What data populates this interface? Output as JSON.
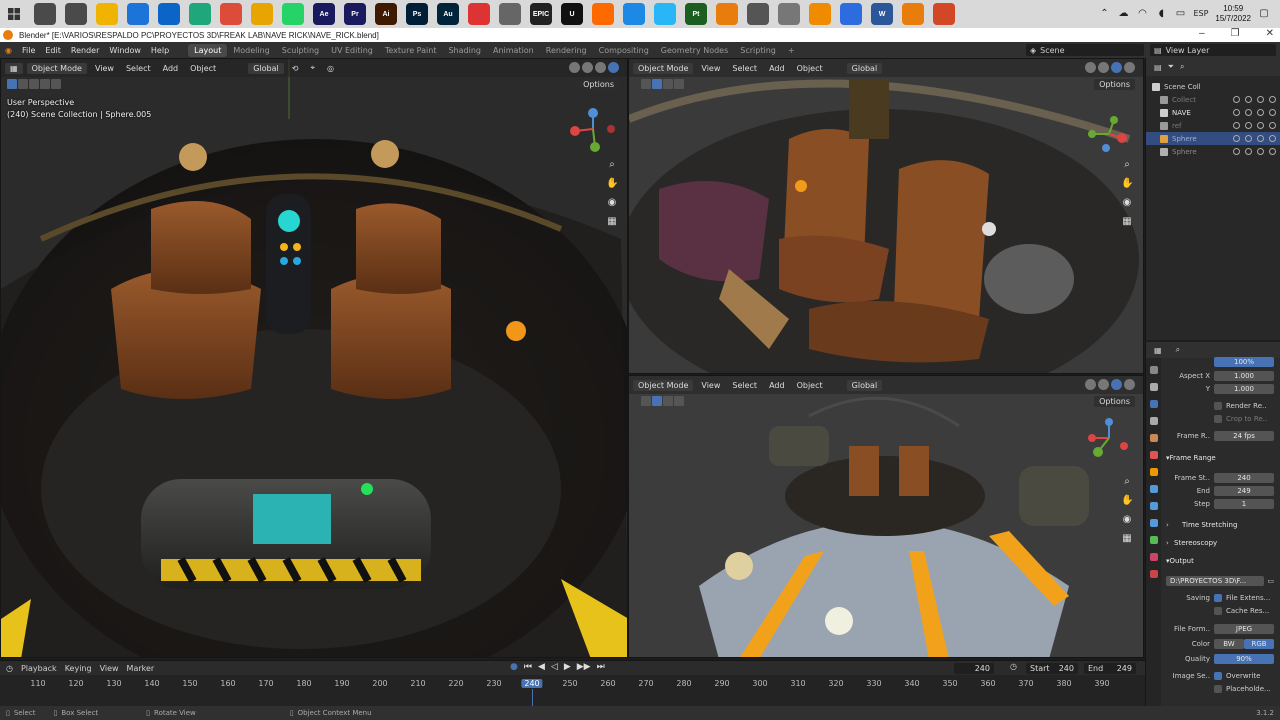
{
  "taskbar": {
    "apps": [
      {
        "name": "search-icon",
        "color": "#4a4a4a",
        "label": ""
      },
      {
        "name": "task-view-icon",
        "color": "#4a4a4a",
        "label": ""
      },
      {
        "name": "file-explorer-icon",
        "color": "#f0b400",
        "label": ""
      },
      {
        "name": "calendar-icon",
        "color": "#1c74d9",
        "label": ""
      },
      {
        "name": "mail-icon",
        "color": "#0d64c7",
        "label": ""
      },
      {
        "name": "edge-icon",
        "color": "#1fa67a",
        "label": ""
      },
      {
        "name": "chrome-icon",
        "color": "#dd4b39",
        "label": ""
      },
      {
        "name": "chrome-alt-icon",
        "color": "#e8a400",
        "label": ""
      },
      {
        "name": "whatsapp-icon",
        "color": "#25d366",
        "label": ""
      },
      {
        "name": "after-effects-icon",
        "color": "#1a1a5e",
        "label": "Ae"
      },
      {
        "name": "premiere-icon",
        "color": "#1a1a5e",
        "label": "Pr"
      },
      {
        "name": "illustrator-icon",
        "color": "#3d1a00",
        "label": "Ai"
      },
      {
        "name": "photoshop-icon",
        "color": "#001e36",
        "label": "Ps"
      },
      {
        "name": "audition-icon",
        "color": "#00243a",
        "label": "Au"
      },
      {
        "name": "app-red-icon",
        "color": "#d33",
        "label": ""
      },
      {
        "name": "app-white-icon",
        "color": "#666",
        "label": ""
      },
      {
        "name": "epic-games-icon",
        "color": "#222",
        "label": "EPIC"
      },
      {
        "name": "unreal-icon",
        "color": "#111",
        "label": "U"
      },
      {
        "name": "app-orange-icon",
        "color": "#ff6a00",
        "label": ""
      },
      {
        "name": "app-blue-icon",
        "color": "#1e88e5",
        "label": ""
      },
      {
        "name": "app-cyan-icon",
        "color": "#29b6f6",
        "label": ""
      },
      {
        "name": "painter-icon",
        "color": "#1b5e20",
        "label": "Pt"
      },
      {
        "name": "blender-alt-icon",
        "color": "#e87d0d",
        "label": ""
      },
      {
        "name": "app-grey-icon",
        "color": "#555",
        "label": ""
      },
      {
        "name": "app-grey2-icon",
        "color": "#777",
        "label": ""
      },
      {
        "name": "vlc-icon",
        "color": "#f08b00",
        "label": ""
      },
      {
        "name": "app-blue2-icon",
        "color": "#2d6cdf",
        "label": ""
      },
      {
        "name": "word-icon",
        "color": "#2b579a",
        "label": "W"
      },
      {
        "name": "blender-icon",
        "color": "#e87d0d",
        "label": ""
      },
      {
        "name": "powerpoint-icon",
        "color": "#d24726",
        "label": ""
      }
    ],
    "lang": "ESP",
    "time": "10:59",
    "date": "15/7/2022"
  },
  "window": {
    "title": "Blender* [E:\\VARIOS\\RESPALDO PC\\PROYECTOS 3D\\FREAK LAB\\NAVE RICK\\NAVE_RICK.blend]"
  },
  "menu": [
    "File",
    "Edit",
    "Render",
    "Window",
    "Help"
  ],
  "workspaces": [
    "Layout",
    "Modeling",
    "Sculpting",
    "UV Editing",
    "Texture Paint",
    "Shading",
    "Animation",
    "Rendering",
    "Compositing",
    "Geometry Nodes",
    "Scripting"
  ],
  "scene": "Scene",
  "view_layer": "View Layer",
  "viewport": {
    "mode": "Object Mode",
    "menus": [
      "View",
      "Select",
      "Add",
      "Object"
    ],
    "transform": "Global",
    "options": "Options",
    "perspective": "User Perspective",
    "collection": "(240) Scene Collection | Sphere.005"
  },
  "outliner": {
    "rows": [
      {
        "label": "Scene Coll",
        "color": "#cfcfcf",
        "sel": false
      },
      {
        "label": "Collect",
        "color": "#7a7a7a",
        "sel": false
      },
      {
        "label": "NAVE",
        "color": "#e6e6e6",
        "sel": false
      },
      {
        "label": "ref",
        "color": "#7a7a7a",
        "sel": false
      },
      {
        "label": "Sphere",
        "color": "#9ab0d6",
        "sel": true
      },
      {
        "label": "Sphere",
        "color": "#8a8a8a",
        "sel": false
      }
    ]
  },
  "properties": {
    "top_value": "100%",
    "aspect_x_label": "Aspect X",
    "aspect_x": "1.000",
    "aspect_y_label": "Y",
    "aspect_y": "1.000",
    "render_region": "Render Re..",
    "crop": "Crop to Re..",
    "frame_rate_label": "Frame R..",
    "frame_rate": "24 fps",
    "frame_range": "Frame Range",
    "frame_start_label": "Frame St..",
    "frame_start": "240",
    "end_label": "End",
    "end": "249",
    "step_label": "Step",
    "step": "1",
    "time_stretching": "Time Stretching",
    "stereoscopy": "Stereoscopy",
    "output": "Output",
    "output_path": "D:\\PROYECTOS 3D\\F...",
    "saving_label": "Saving",
    "file_ext": "File Extens...",
    "cache_result": "Cache Res...",
    "file_format_label": "File Form..",
    "file_format": "JPEG",
    "color_label": "Color",
    "bw": "BW",
    "rgb": "RGB",
    "quality_label": "Quality",
    "quality": "90%",
    "image_seq_label": "Image Se..",
    "overwrite": "Overwrite",
    "placeholders": "Placeholde..."
  },
  "timeline": {
    "menus": [
      "Playback",
      "Keying",
      "View",
      "Marker"
    ],
    "current": "240",
    "start_label": "Start",
    "start": "240",
    "end_label": "End",
    "end": "249",
    "ticks": [
      "110",
      "120",
      "130",
      "140",
      "150",
      "160",
      "170",
      "180",
      "190",
      "200",
      "210",
      "220",
      "230",
      "240",
      "250",
      "260",
      "270",
      "280",
      "290",
      "300",
      "310",
      "320",
      "330",
      "340",
      "350",
      "360",
      "370",
      "380",
      "390"
    ]
  },
  "status": {
    "select": "Select",
    "box_select": "Box Select",
    "rotate_view": "Rotate View",
    "context_menu": "Object Context Menu",
    "version": "3.1.2"
  }
}
